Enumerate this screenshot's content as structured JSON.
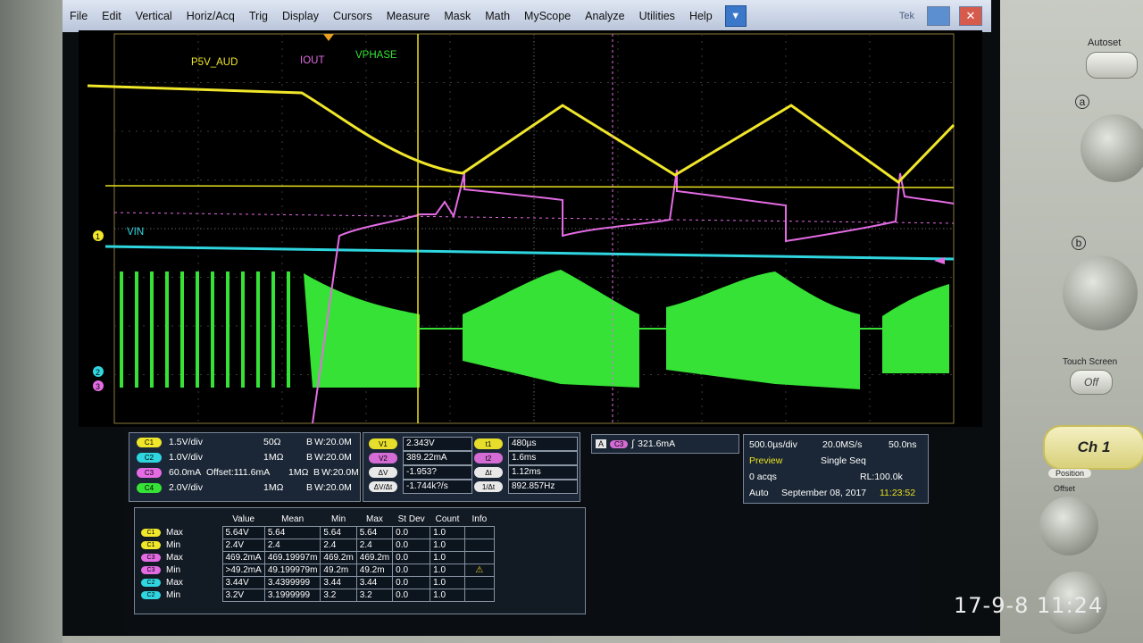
{
  "menu": {
    "items": [
      "File",
      "Edit",
      "Vertical",
      "Horiz/Acq",
      "Trig",
      "Display",
      "Cursors",
      "Measure",
      "Mask",
      "Math",
      "MyScope",
      "Analyze",
      "Utilities",
      "Help"
    ],
    "brand_partial": "Tek"
  },
  "colors": {
    "ch1": "#f0e62a",
    "ch2": "#2fd6e0",
    "ch3": "#e46be4",
    "ch4": "#36e236",
    "cursor": "#e8e020",
    "background": "#000000"
  },
  "waveform_labels": {
    "ch1": "P5V_AUD",
    "ch3": "IOUT",
    "ch4": "VPHASE",
    "ch2": "VIN"
  },
  "channel_markers": [
    "1",
    "2",
    "3"
  ],
  "channels": [
    {
      "badge": "C1",
      "scale": "1.5V/div",
      "coupling": "50Ω",
      "bw": "B W:20.0M",
      "offset": ""
    },
    {
      "badge": "C2",
      "scale": "1.0V/div",
      "coupling": "1MΩ",
      "bw": "B W:20.0M",
      "offset": ""
    },
    {
      "badge": "C3",
      "scale": "60.0mA",
      "coupling": "1MΩ",
      "bw": "B W:20.0M",
      "offset": "Offset:111.6mA"
    },
    {
      "badge": "C4",
      "scale": "2.0V/div",
      "coupling": "1MΩ",
      "bw": "B W:20.0M",
      "offset": ""
    }
  ],
  "cursors": {
    "v1": {
      "label": "V1",
      "value": "2.343V"
    },
    "v2": {
      "label": "V2",
      "value": "389.22mA"
    },
    "dv": {
      "label": "ΔV",
      "value": "-1.953?"
    },
    "dvdt": {
      "label": "ΔV/Δt",
      "value": "-1.744k?/s"
    },
    "t1": {
      "label": "t1",
      "value": "480µs"
    },
    "t2": {
      "label": "t2",
      "value": "1.6ms"
    },
    "dt": {
      "label": "Δt",
      "value": "1.12ms"
    },
    "inv_dt": {
      "label": "1/Δt",
      "value": "892.857Hz"
    }
  },
  "trigger": {
    "source": "A",
    "channel": "C3",
    "slope": "∫",
    "level": "321.6mA"
  },
  "horizontal": {
    "scale": "500.0µs/div",
    "sample_rate": "20.0MS/s",
    "resolution": "50.0ns",
    "mode": "Preview",
    "acq_mode": "Single Seq",
    "acqs": "0 acqs",
    "record_length": "RL:100.0k",
    "trigger_mode": "Auto",
    "date": "September 08, 2017",
    "time": "11:23:52"
  },
  "measurements": {
    "headers": [
      "Value",
      "Mean",
      "Min",
      "Max",
      "St Dev",
      "Count",
      "Info"
    ],
    "rows": [
      {
        "ch": "C1",
        "stat": "Max",
        "value": "5.64V",
        "mean": "5.64",
        "min": "5.64",
        "max": "5.64",
        "stdev": "0.0",
        "count": "1.0",
        "info": ""
      },
      {
        "ch": "C1",
        "stat": "Min",
        "value": "2.4V",
        "mean": "2.4",
        "min": "2.4",
        "max": "2.4",
        "stdev": "0.0",
        "count": "1.0",
        "info": ""
      },
      {
        "ch": "C3",
        "stat": "Max",
        "value": "469.2mA",
        "mean": "469.19997m",
        "min": "469.2m",
        "max": "469.2m",
        "stdev": "0.0",
        "count": "1.0",
        "info": ""
      },
      {
        "ch": "C3",
        "stat": "Min",
        "value": ">49.2mA",
        "mean": "49.199979m",
        "min": "49.2m",
        "max": "49.2m",
        "stdev": "0.0",
        "count": "1.0",
        "info": "warning"
      },
      {
        "ch": "C2",
        "stat": "Max",
        "value": "3.44V",
        "mean": "3.4399999",
        "min": "3.44",
        "max": "3.44",
        "stdev": "0.0",
        "count": "1.0",
        "info": ""
      },
      {
        "ch": "C2",
        "stat": "Min",
        "value": "3.2V",
        "mean": "3.1999999",
        "min": "3.2",
        "max": "3.2",
        "stdev": "0.0",
        "count": "1.0",
        "info": ""
      }
    ]
  },
  "front_panel": {
    "autoset": "Autoset",
    "knob_a": "a",
    "knob_b": "b",
    "touch_screen": "Touch Screen",
    "touch_off": "Off",
    "ch1_button": "Ch 1",
    "position": "Position",
    "offset": "Offset"
  },
  "photo_timestamp": "17-9-8 11:24"
}
